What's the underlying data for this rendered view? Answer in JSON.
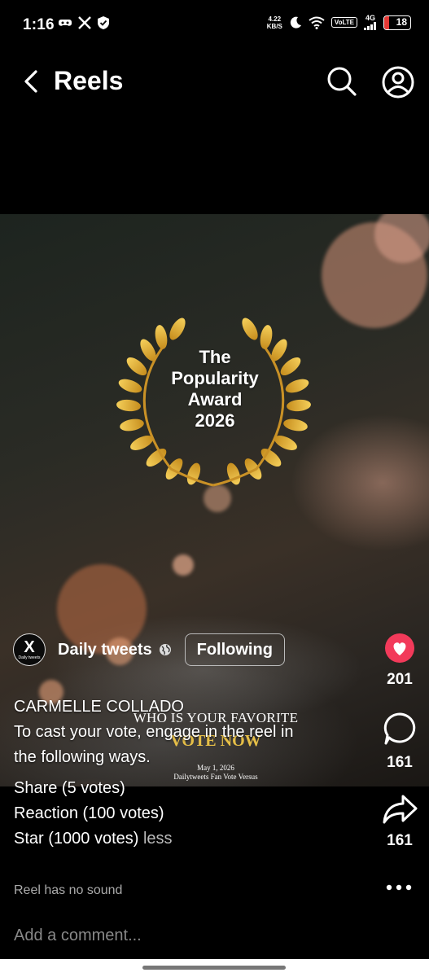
{
  "status_bar": {
    "time": "1:16",
    "speed_value": "4.22",
    "speed_unit": "KB/S",
    "volte": "VoLTE",
    "network": "4G",
    "battery": "18",
    "battery_color": "#e53935"
  },
  "header": {
    "title": "Reels",
    "back_icon": "chevron-left-icon",
    "search_icon": "search-icon",
    "profile_icon": "user-circle-icon"
  },
  "video": {
    "award_lines": [
      "The",
      "Popularity",
      "Award",
      "2026"
    ],
    "overlay_question": "WHO IS YOUR FAVORITE",
    "overlay_cta": "VOTE NOW",
    "overlay_date": "May 1, 2026",
    "overlay_footer": "Dailytweets Fan Vote Versus",
    "accent_gold": "#e6bf47"
  },
  "author": {
    "avatar_letter": "X",
    "avatar_caption": "Daily tweets",
    "name": "Daily tweets",
    "follow_label": "Following"
  },
  "caption": {
    "line1": "CARMELLE COLLADO",
    "line2": "To cast your vote, engage in the reel in",
    "line3": "the following ways.",
    "line4": "Share (5 votes)",
    "line5": "Reaction (100 votes)",
    "line6": "Star (1000 votes)",
    "less": "less"
  },
  "sound_note": "Reel has no sound",
  "actions": {
    "likes": "201",
    "comments": "161",
    "shares": "161",
    "like_color": "#f23a5a"
  },
  "comment_bar": {
    "placeholder": "Add a comment..."
  }
}
